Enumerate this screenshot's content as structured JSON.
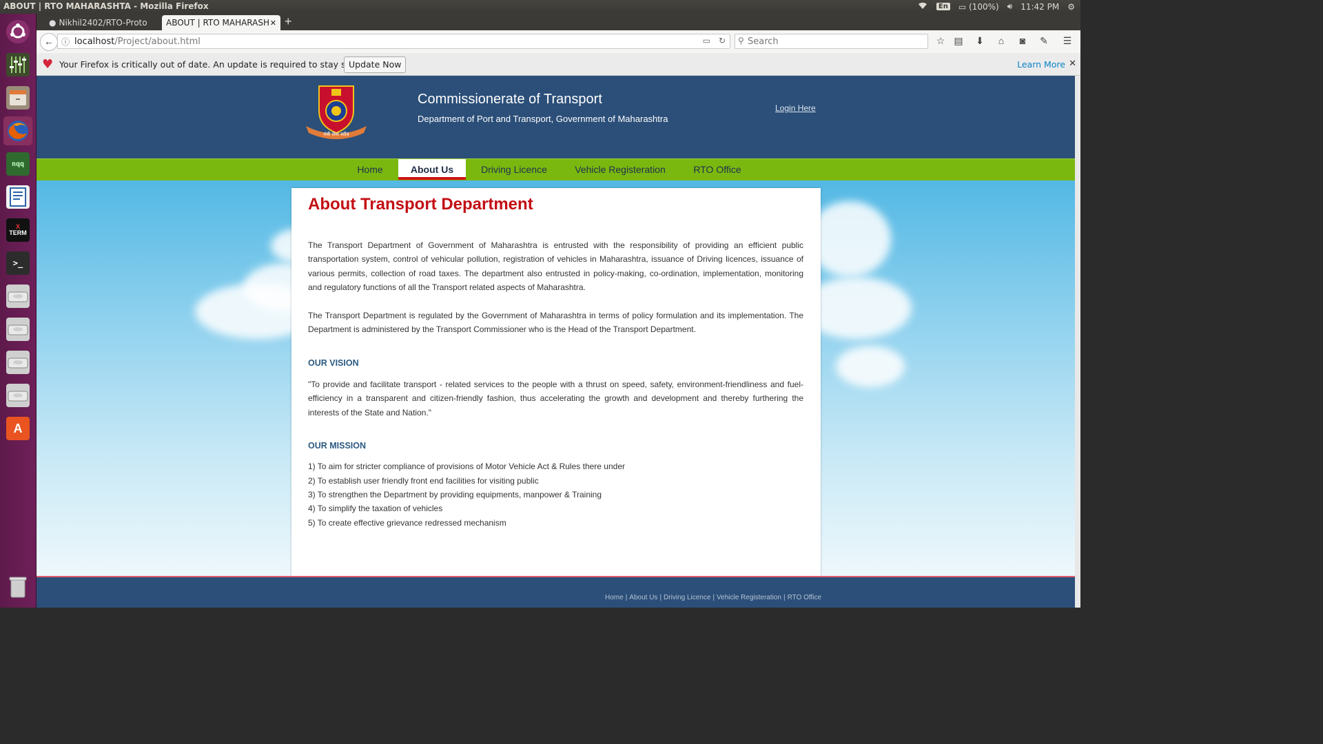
{
  "os": {
    "window_title": "ABOUT | RTO MAHARASHTA - Mozilla Firefox",
    "keyboard": "En",
    "battery": "(100%)",
    "time": "11:42 PM"
  },
  "browser": {
    "tabs": [
      {
        "label": "Nikhil2402/RTO-Proto"
      },
      {
        "label": "ABOUT | RTO MAHARASH"
      }
    ],
    "url_host": "localhost",
    "url_path": "/Project/about.html",
    "search_placeholder": "Search",
    "notification": {
      "message": "Your Firefox is critically out of date. An update is required to stay secure",
      "update_button": "Update Now",
      "learn_more": "Learn More"
    }
  },
  "site": {
    "emblem_text": "मंत्री सेवा सदैव",
    "title": "Commissionerate of Transport",
    "subtitle": "Department of Port and Transport, Government of Maharashtra",
    "login": "Login Here",
    "menu": [
      "Home",
      "About Us",
      "Driving Licence",
      "Vehicle Registeration",
      "RTO Office"
    ],
    "active_menu": "About Us"
  },
  "content": {
    "heading": "About Transport Department",
    "paragraphs": [
      "The Transport Department of Government of Maharashtra is entrusted with the responsibility of providing an efficient public transportation system, control of vehicular pollution, registration of vehicles in Maharashtra, issuance of Driving licences, issuance of various permits, collection of road taxes. The department also entrusted in policy-making, co-ordination, implementation, monitoring and regulatory functions of all the Transport related aspects of Maharashtra.",
      "The Transport Department is regulated by the Government of Maharashtra in terms of policy formulation and its implementation. The Department is administered by the Transport Commissioner who is the Head of the Transport Department."
    ],
    "vision_heading": "OUR VISION",
    "vision_text": "\"To provide and facilitate transport - related services to the people with a thrust on speed, safety, environment-friendliness and fuel-efficiency in a transparent and citizen-friendly fashion, thus accelerating the growth and development and thereby furthering the interests of the State and Nation.\"",
    "mission_heading": "OUR MISSION",
    "mission_items": [
      "1) To aim for stricter compliance of provisions of Motor Vehicle Act & Rules there under",
      "2) To establish user friendly front end facilities for visiting public",
      "3) To strengthen the Department by providing equipments, manpower & Training",
      "4) To simplify the taxation of vehicles",
      "5) To create effective grievance redressed mechanism"
    ]
  },
  "footer": {
    "links": [
      "Home",
      "About Us",
      "Driving Licence",
      "Vehicle Registeration",
      "RTO Office"
    ]
  }
}
